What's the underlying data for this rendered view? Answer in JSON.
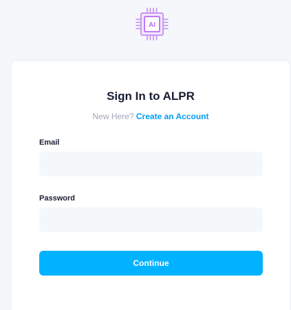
{
  "logo": {
    "text": "AI",
    "icon": "ai-chip-icon",
    "color": "#b86bf0"
  },
  "form": {
    "title": "Sign In to ALPR",
    "new_here": "New Here?",
    "create_account": "Create an Account",
    "email_label": "Email",
    "email_value": "",
    "password_label": "Password",
    "password_value": "",
    "continue_label": "Continue"
  },
  "colors": {
    "accent": "#00b2ff",
    "link": "#009ef7",
    "input_bg": "#f5f8fa",
    "muted_text": "#a1a5b7"
  }
}
